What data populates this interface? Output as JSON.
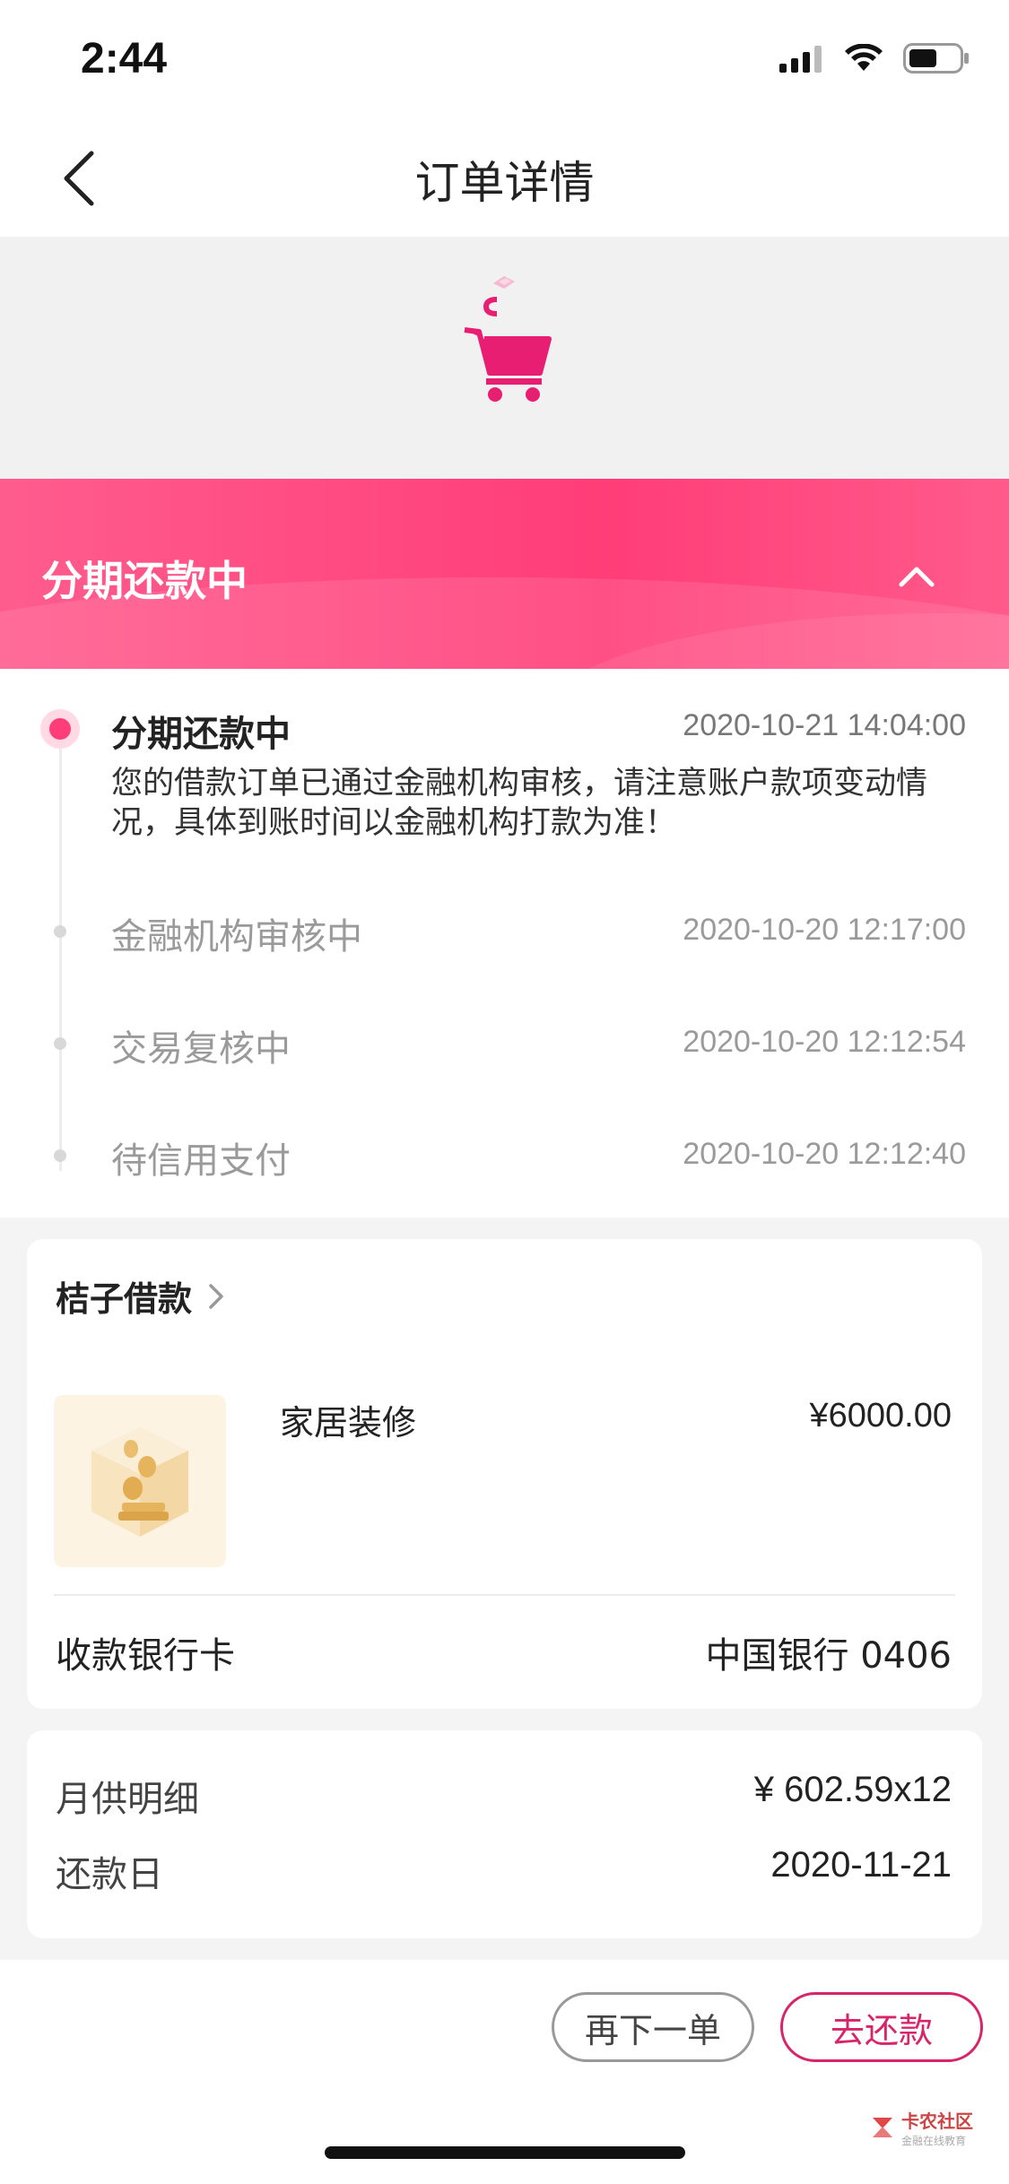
{
  "status_bar": {
    "time": "2:44"
  },
  "nav": {
    "title": "订单详情"
  },
  "banner": {
    "title": "分期还款中"
  },
  "timeline": {
    "active": {
      "title": "分期还款中",
      "time": "2020-10-21 14:04:00",
      "desc": "您的借款订单已通过金融机构审核，请注意账户款项变动情况，具体到账时间以金融机构打款为准！"
    },
    "items": [
      {
        "title": "金融机构审核中",
        "time": "2020-10-20 12:17:00"
      },
      {
        "title": "交易复核中",
        "time": "2020-10-20 12:12:54"
      },
      {
        "title": "待信用支付",
        "time": "2020-10-20 12:12:40"
      }
    ]
  },
  "product_card": {
    "merchant": "桔子借款",
    "product_name": "家居装修",
    "price": "¥6000.00",
    "bank_label": "收款银行卡",
    "bank_value": "中国银行 0406"
  },
  "repay_card": {
    "monthly_label": "月供明细",
    "monthly_value": "¥ 602.59x12",
    "due_label": "还款日",
    "due_value": "2020-11-21"
  },
  "actions": {
    "reorder": "再下一单",
    "repay": "去还款"
  },
  "watermark": {
    "title": "卡农社区",
    "subtitle": "金融在线教育"
  },
  "colors": {
    "accent": "#ff3d78",
    "button_accent": "#d8246a"
  }
}
